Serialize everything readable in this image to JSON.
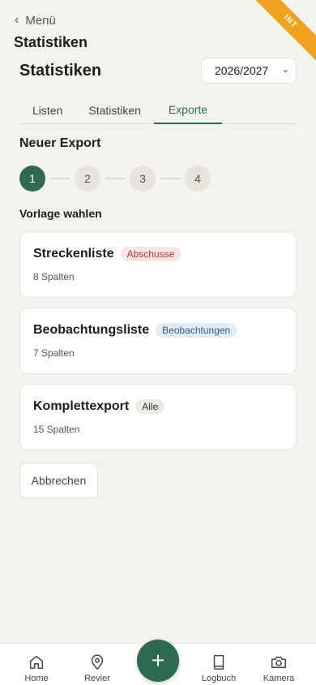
{
  "env_badge": "INT",
  "nav_back": {
    "label": "Menü"
  },
  "header": {
    "title": "Statistiken"
  },
  "page": {
    "title": "Statistiken",
    "season": "2026/2027"
  },
  "tabs": [
    {
      "label": "Listen"
    },
    {
      "label": "Statistiken"
    },
    {
      "label": "Exporte"
    }
  ],
  "export": {
    "title": "Neuer Export",
    "steps": [
      "1",
      "2",
      "3",
      "4"
    ],
    "active_step": 1,
    "subtitle": "Vorlage wahlen",
    "templates": [
      {
        "name": "Streckenliste",
        "badge": "Abschusse",
        "columns": "8 Spalten"
      },
      {
        "name": "Beobachtungsliste",
        "badge": "Beobachtungen",
        "columns": "7 Spalten"
      },
      {
        "name": "Komplettexport",
        "badge": "Alle",
        "columns": "15 Spalten"
      }
    ],
    "cancel_label": "Abbrechen"
  },
  "bottom_nav": {
    "items": [
      {
        "label": "Home",
        "icon": "home-icon"
      },
      {
        "label": "Revier",
        "icon": "map-pin-icon"
      },
      {
        "label": "Logbuch",
        "icon": "book-icon"
      },
      {
        "label": "Kamera",
        "icon": "camera-icon"
      }
    ],
    "fab_icon": "plus-icon"
  },
  "colors": {
    "accent": "#2d6a4f",
    "env_badge": "#f0a21c"
  }
}
